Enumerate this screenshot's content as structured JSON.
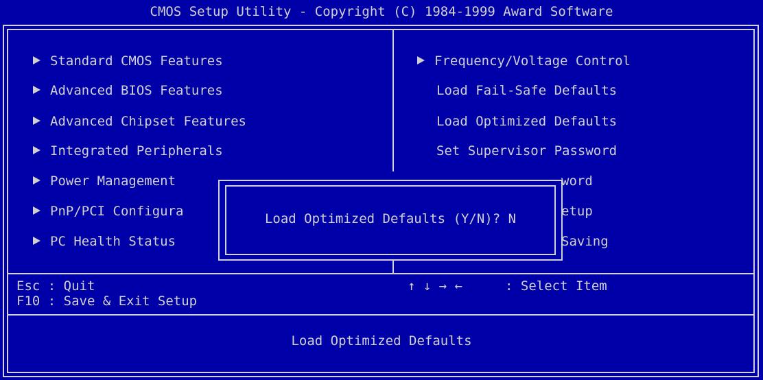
{
  "title": "CMOS Setup Utility - Copyright (C) 1984-1999 Award Software",
  "left_menu": [
    {
      "label": "Standard CMOS Features",
      "submenu": true
    },
    {
      "label": "Advanced BIOS Features",
      "submenu": true
    },
    {
      "label": "Advanced Chipset Features",
      "submenu": true
    },
    {
      "label": "Integrated Peripherals",
      "submenu": true
    },
    {
      "label": "Power Management",
      "submenu": true
    },
    {
      "label": "PnP/PCI Configura",
      "submenu": true
    },
    {
      "label": "PC Health Status",
      "submenu": true
    }
  ],
  "right_menu": [
    {
      "label": "Frequency/Voltage Control",
      "submenu": true
    },
    {
      "label": "Load Fail-Safe Defaults",
      "submenu": false
    },
    {
      "label": "Load Optimized Defaults",
      "submenu": false
    },
    {
      "label": "Set Supervisor Password",
      "submenu": false
    },
    {
      "label": "word",
      "submenu": false
    },
    {
      "label": "etup",
      "submenu": false
    },
    {
      "label": "Saving",
      "submenu": false
    }
  ],
  "dialog": {
    "prompt": "Load Optimized Defaults (Y/N)? N"
  },
  "help": {
    "esc": "Esc : Quit",
    "f10": "F10 : Save & Exit Setup",
    "arrows": "↑ ↓ → ←",
    "select": ": Select Item"
  },
  "status": "Load Optimized Defaults",
  "colors": {
    "background": "#0000A8",
    "foreground": "#D0D0D0"
  }
}
